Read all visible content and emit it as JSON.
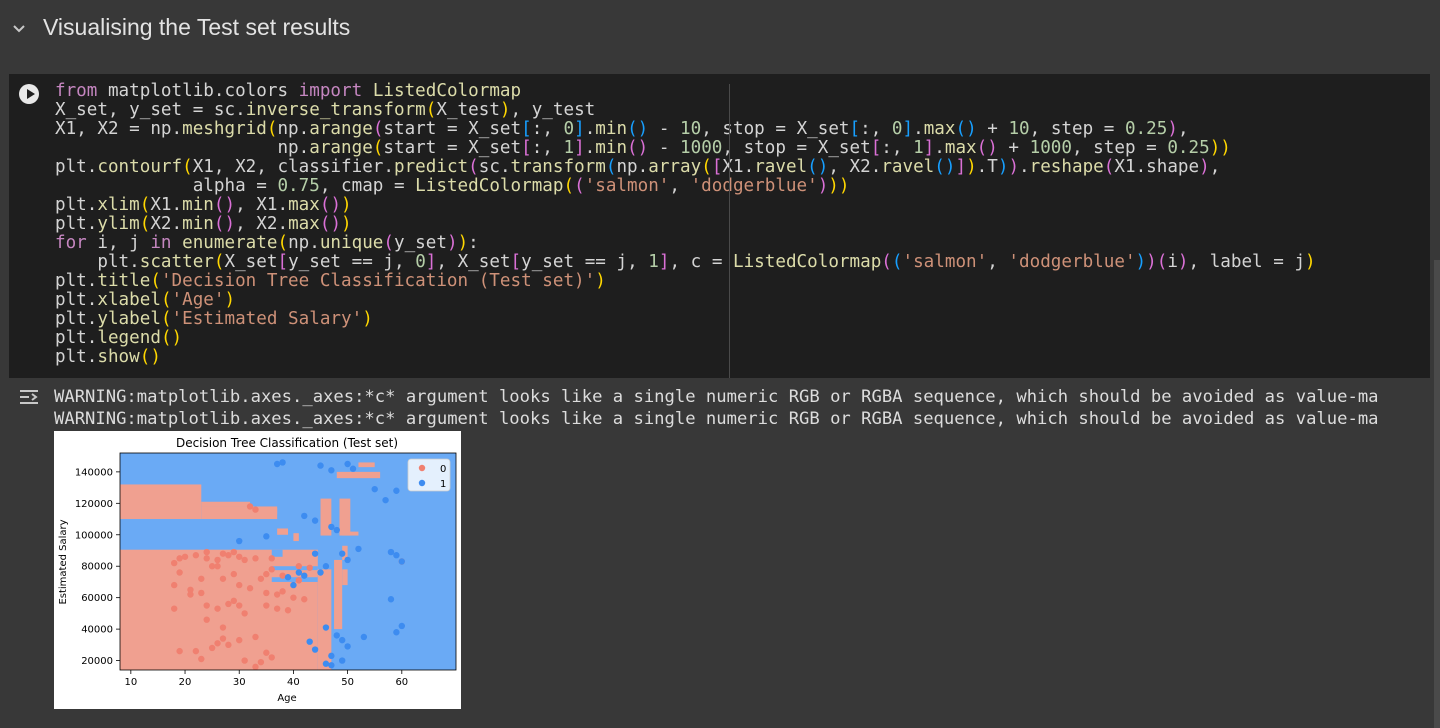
{
  "section": {
    "title": "Visualising the Test set results"
  },
  "code_lines": [
    "from matplotlib.colors import ListedColormap",
    "X_set, y_set = sc.inverse_transform(X_test), y_test",
    "X1, X2 = np.meshgrid(np.arange(start = X_set[:, 0].min() - 10, stop = X_set[:, 0].max() + 10, step = 0.25),",
    "                     np.arange(start = X_set[:, 1].min() - 1000, stop = X_set[:, 1].max() + 1000, step = 0.25))",
    "plt.contourf(X1, X2, classifier.predict(sc.transform(np.array([X1.ravel(), X2.ravel()]).T)).reshape(X1.shape),",
    "             alpha = 0.75, cmap = ListedColormap(('salmon', 'dodgerblue')))",
    "plt.xlim(X1.min(), X1.max())",
    "plt.ylim(X2.min(), X2.max())",
    "for i, j in enumerate(np.unique(y_set)):",
    "    plt.scatter(X_set[y_set == j, 0], X_set[y_set == j, 1], c = ListedColormap(('salmon', 'dodgerblue'))(i), label = j)",
    "plt.title('Decision Tree Classification (Test set)')",
    "plt.xlabel('Age')",
    "plt.ylabel('Estimated Salary')",
    "plt.legend()",
    "plt.show()"
  ],
  "output": {
    "warnings": [
      "WARNING:matplotlib.axes._axes:*c* argument looks like a single numeric RGB or RGBA sequence, which should be avoided as value-ma",
      "WARNING:matplotlib.axes._axes:*c* argument looks like a single numeric RGB or RGBA sequence, which should be avoided as value-ma"
    ]
  },
  "chart_data": {
    "type": "scatter",
    "title": "Decision Tree Classification (Test set)",
    "xlabel": "Age",
    "ylabel": "Estimated Salary",
    "xlim": [
      8,
      70
    ],
    "ylim": [
      14000,
      152000
    ],
    "xticks": [
      10,
      20,
      30,
      40,
      50,
      60
    ],
    "yticks": [
      20000,
      40000,
      60000,
      80000,
      100000,
      120000,
      140000
    ],
    "legend_position": "top-right",
    "colors": {
      "class_0": "#f08070",
      "class_1": "#3d8cf0",
      "region_0": "#f0a090",
      "region_1": "#6aaaf5"
    },
    "series": [
      {
        "name": "0",
        "points": [
          [
            18,
            82000
          ],
          [
            19,
            85000
          ],
          [
            19,
            76000
          ],
          [
            20,
            86000
          ],
          [
            22,
            87000
          ],
          [
            24,
            89000
          ],
          [
            24,
            85000
          ],
          [
            25,
            80000
          ],
          [
            26,
            84000
          ],
          [
            27,
            88000
          ],
          [
            28,
            87000
          ],
          [
            29,
            89000
          ],
          [
            30,
            86000
          ],
          [
            31,
            84000
          ],
          [
            33,
            85000
          ],
          [
            18,
            68000
          ],
          [
            18,
            53000
          ],
          [
            21,
            62000
          ],
          [
            23,
            63000
          ],
          [
            24,
            55000
          ],
          [
            24,
            46000
          ],
          [
            26,
            53000
          ],
          [
            27,
            41000
          ],
          [
            28,
            56000
          ],
          [
            29,
            58000
          ],
          [
            30,
            55000
          ],
          [
            31,
            50000
          ],
          [
            35,
            63000
          ],
          [
            35,
            55000
          ],
          [
            37,
            62000
          ],
          [
            37,
            53000
          ],
          [
            39,
            52000
          ],
          [
            19,
            26000
          ],
          [
            22,
            26000
          ],
          [
            23,
            21000
          ],
          [
            25,
            28000
          ],
          [
            26,
            31000
          ],
          [
            27,
            34000
          ],
          [
            28,
            30000
          ],
          [
            30,
            33000
          ],
          [
            31,
            20000
          ],
          [
            33,
            35000
          ],
          [
            33,
            16000
          ],
          [
            34,
            19000
          ],
          [
            35,
            25000
          ],
          [
            36,
            22000
          ],
          [
            36,
            85000
          ],
          [
            36,
            78000
          ],
          [
            38,
            74000
          ],
          [
            38,
            64000
          ],
          [
            40,
            60000
          ],
          [
            41,
            71000
          ],
          [
            41,
            80000
          ],
          [
            42,
            59000
          ],
          [
            43,
            79000
          ],
          [
            35,
            75000
          ],
          [
            21,
            65000
          ],
          [
            23,
            72000
          ],
          [
            27,
            72000
          ],
          [
            29,
            75000
          ],
          [
            30,
            68000
          ],
          [
            32,
            66000
          ],
          [
            34,
            72000
          ],
          [
            32,
            118000
          ],
          [
            33,
            116000
          ],
          [
            26,
            80000
          ],
          [
            60,
            83000
          ]
        ]
      },
      {
        "name": "1",
        "points": [
          [
            30,
            96000
          ],
          [
            35,
            99000
          ],
          [
            37,
            145000
          ],
          [
            38,
            146000
          ],
          [
            39,
            73000
          ],
          [
            42,
            112000
          ],
          [
            44,
            109000
          ],
          [
            45,
            144000
          ],
          [
            47,
            141000
          ],
          [
            47,
            105000
          ],
          [
            48,
            103000
          ],
          [
            49,
            88000
          ],
          [
            50,
            145000
          ],
          [
            51,
            142000
          ],
          [
            52,
            91000
          ],
          [
            55,
            129000
          ],
          [
            57,
            122000
          ],
          [
            58,
            59000
          ],
          [
            59,
            87000
          ],
          [
            59,
            38000
          ],
          [
            59,
            128000
          ],
          [
            60,
            42000
          ],
          [
            60,
            83000
          ],
          [
            43,
            32000
          ],
          [
            44,
            27000
          ],
          [
            46,
            41000
          ],
          [
            48,
            36000
          ],
          [
            49,
            33000
          ],
          [
            50,
            29000
          ],
          [
            53,
            35000
          ],
          [
            47,
            23000
          ],
          [
            46,
            18000
          ],
          [
            47,
            17000
          ],
          [
            49,
            20000
          ],
          [
            45,
            76000
          ],
          [
            41,
            76000
          ],
          [
            40,
            68000
          ],
          [
            44,
            88000
          ],
          [
            42,
            74000
          ],
          [
            46,
            80000
          ],
          [
            50,
            84000
          ],
          [
            58,
            89000
          ]
        ]
      }
    ]
  }
}
